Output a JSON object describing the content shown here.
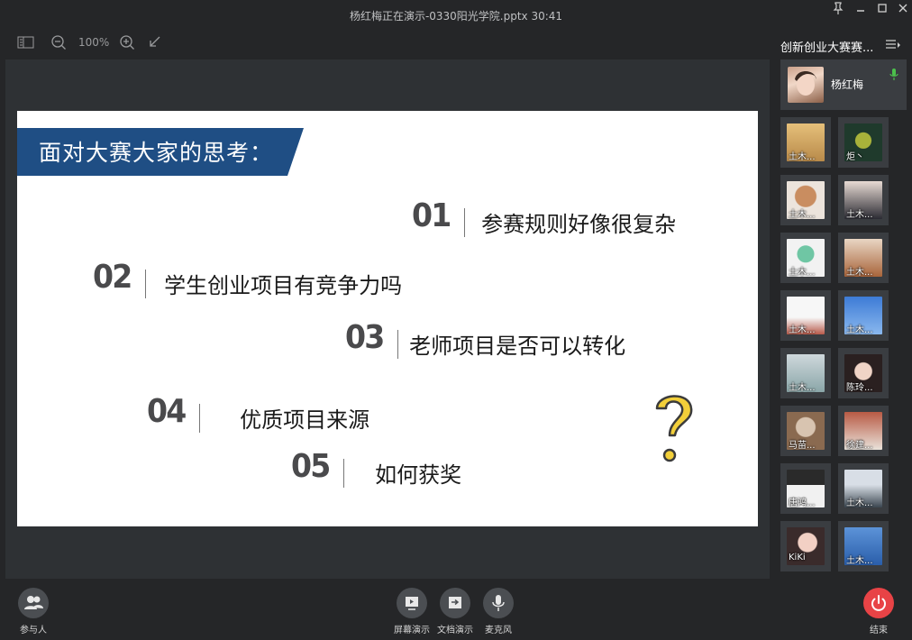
{
  "window": {
    "title": "杨红梅正在演示-0330阳光学院.pptx 30:41"
  },
  "toolbar": {
    "zoom": "100%"
  },
  "slide": {
    "heading": "面对大赛大家的思考：",
    "items": [
      {
        "num": "01",
        "text": "参赛规则好像很复杂"
      },
      {
        "num": "02",
        "text": "学生创业项目有竞争力吗"
      },
      {
        "num": "03",
        "text": "老师项目是否可以转化"
      },
      {
        "num": "04",
        "text": "优质项目来源"
      },
      {
        "num": "05",
        "text": "如何获奖"
      }
    ]
  },
  "sidebar": {
    "title": "创新创业大赛赛...",
    "self": {
      "name": "杨红梅"
    },
    "participants": [
      {
        "label": "土木..."
      },
      {
        "label": "炬丶"
      },
      {
        "label": "土木..."
      },
      {
        "label": "土木..."
      },
      {
        "label": "土木..."
      },
      {
        "label": "土木..."
      },
      {
        "label": "土木..."
      },
      {
        "label": "土木..."
      },
      {
        "label": "土木..."
      },
      {
        "label": "陈玲..."
      },
      {
        "label": "马苗..."
      },
      {
        "label": "徐建..."
      },
      {
        "label": "唐鸿..."
      },
      {
        "label": "土木..."
      },
      {
        "label": "KiKi"
      },
      {
        "label": "土木..."
      }
    ]
  },
  "bottombar": {
    "participants_label": "参与人",
    "screen_share_label": "屏幕演示",
    "doc_share_label": "文档演示",
    "mic_label": "麦克风",
    "end_label": "结束"
  },
  "colors": {
    "banner": "#1f4e84",
    "end": "#e84346",
    "accent_green": "#4cc04c"
  }
}
